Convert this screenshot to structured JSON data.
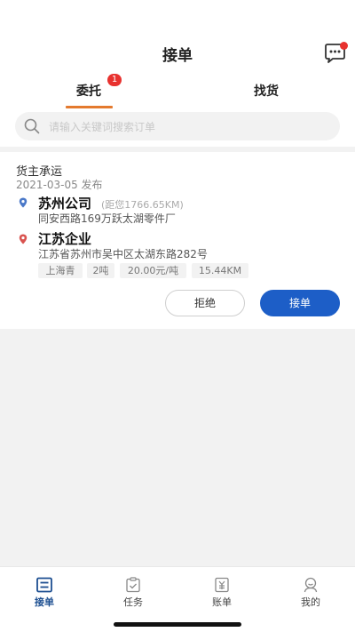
{
  "header": {
    "title": "接单",
    "message_icon": "chat-bubble-icon"
  },
  "tabs": [
    {
      "label": "委托",
      "badge": "1",
      "active": true
    },
    {
      "label": "找货",
      "active": false
    }
  ],
  "search": {
    "placeholder": "请输入关键词搜索订单",
    "icon": "search-icon"
  },
  "order": {
    "type": "货主承运",
    "date": "2021-03-05 发布",
    "origin": {
      "name": "苏州公司",
      "distance": "(距您1766.65KM)",
      "address": "同安西路169万跃太湖零件厂"
    },
    "destination": {
      "name": "江苏企业",
      "address": "江苏省苏州市吴中区太湖东路282号"
    },
    "tags": [
      "上海青",
      "2吨",
      "20.00元/吨",
      "15.44KM"
    ],
    "reject_label": "拒绝",
    "accept_label": "接单"
  },
  "bottom_nav": [
    {
      "label": "接单",
      "icon": "list-icon",
      "active": true
    },
    {
      "label": "任务",
      "icon": "task-icon",
      "active": false
    },
    {
      "label": "账单",
      "icon": "bill-icon",
      "active": false
    },
    {
      "label": "我的",
      "icon": "profile-icon",
      "active": false
    }
  ],
  "colors": {
    "accent_blue": "#1d5ec7",
    "nav_active": "#1d4f91",
    "tab_underline": "#e47a2e",
    "badge_red": "#e8322f"
  }
}
